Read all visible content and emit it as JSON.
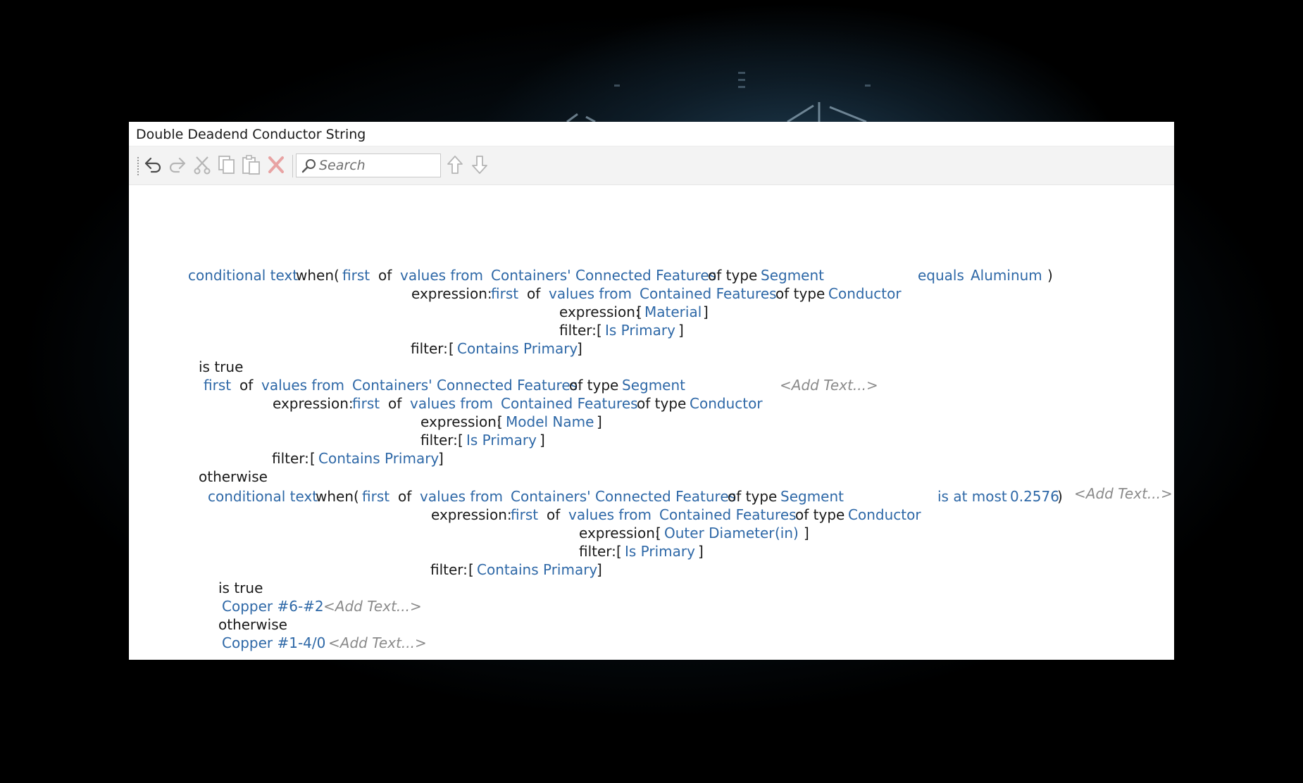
{
  "window": {
    "title": "Double Deadend Conductor String"
  },
  "toolbar": {
    "search_placeholder": "Search",
    "icons": [
      "undo-icon",
      "redo-icon",
      "cut-icon",
      "copy-icon",
      "paste-icon",
      "delete-icon",
      "search-icon",
      "move-up-icon",
      "move-down-icon"
    ]
  },
  "colors": {
    "link": "#2e68a7",
    "keyword": "#1a1a1a",
    "placeholder": "#8a8a8a",
    "panel": "#ffffff",
    "toolbar": "#f3f3f3"
  },
  "expr": {
    "cond1": {
      "label": "conditional text",
      "when": "when(",
      "first": "first",
      "of": "of",
      "values_from": "values from",
      "source": "Containers' Connected Features",
      "of_type": "of type",
      "type": "Segment",
      "op": "equals",
      "value": "Aluminum",
      "close": ")",
      "expression_label": "expression:",
      "inner": {
        "first": "first",
        "of": "of",
        "values_from": "values from",
        "source": "Contained Features",
        "of_type": "of type",
        "type": "Conductor",
        "expression_label": "expression:",
        "open": "[",
        "field": "Material",
        "close": "]",
        "filter_label": "filter:",
        "filter_open": "[",
        "filter": "Is Primary",
        "filter_close": "]"
      },
      "filter_label": "filter:",
      "filter_open": "[",
      "filter": "Contains Primary",
      "filter_close": "]",
      "is_true": "is true",
      "true_branch": {
        "first": "first",
        "of": "of",
        "values_from": "values from",
        "source": "Containers' Connected Features",
        "of_type": "of type",
        "type": "Segment",
        "add_text": "<Add Text...>",
        "expression_label": "expression:",
        "inner": {
          "first": "first",
          "of": "of",
          "values_from": "values from",
          "source": "Contained Features",
          "of_type": "of type",
          "type": "Conductor",
          "expression_label": "expression:",
          "open": "[",
          "field": "Model Name",
          "close": "]",
          "filter_label": "filter:",
          "filter_open": "[",
          "filter": "Is Primary",
          "filter_close": "]"
        },
        "filter_label": "filter:",
        "filter_open": "[",
        "filter": "Contains Primary",
        "filter_close": "]"
      },
      "otherwise": "otherwise"
    },
    "cond2": {
      "label": "conditional text",
      "when": "when(",
      "first": "first",
      "of": "of",
      "values_from": "values from",
      "source": "Containers' Connected Features",
      "of_type": "of type",
      "type": "Segment",
      "op": "is at most",
      "value": "0.2576",
      "close": ")",
      "add_text": "<Add Text...>",
      "expression_label": "expression:",
      "inner": {
        "first": "first",
        "of": "of",
        "values_from": "values from",
        "source": "Contained Features",
        "of_type": "of type",
        "type": "Conductor",
        "expression_label": "expression:",
        "open": "[",
        "field": "Outer Diameter",
        "unit": "(in)",
        "close": "]",
        "filter_label": "filter:",
        "filter_open": "[",
        "filter": "Is Primary",
        "filter_close": "]"
      },
      "filter_label": "filter:",
      "filter_open": "[",
      "filter": "Contains Primary",
      "filter_close": "]",
      "is_true": "is true",
      "true_value": "Copper #6-#2",
      "true_add_text": "<Add Text...>",
      "otherwise": "otherwise",
      "else_value": "Copper #1-4/0",
      "else_add_text": "<Add Text...>"
    }
  }
}
